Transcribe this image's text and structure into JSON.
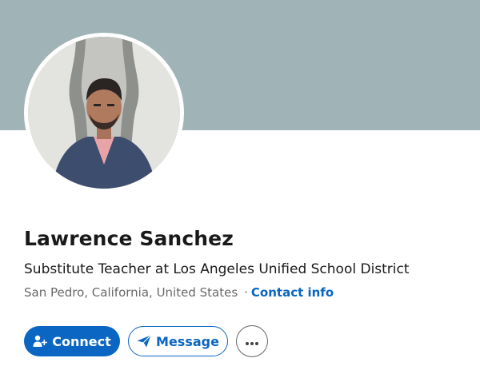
{
  "profile": {
    "name": "Lawrence Sanchez",
    "headline": "Substitute Teacher at Los Angeles Unified School District",
    "location": "San Pedro, California, United States",
    "separator": "·",
    "contact_info_label": "Contact info"
  },
  "actions": {
    "connect_label": "Connect",
    "message_label": "Message",
    "more_icon": "ellipsis-icon",
    "connect_icon": "add-person-icon",
    "message_icon": "paper-plane-icon"
  },
  "colors": {
    "cover": "#a0b4b7",
    "primary": "#0a66c2",
    "text": "#191919",
    "muted": "#666666"
  }
}
